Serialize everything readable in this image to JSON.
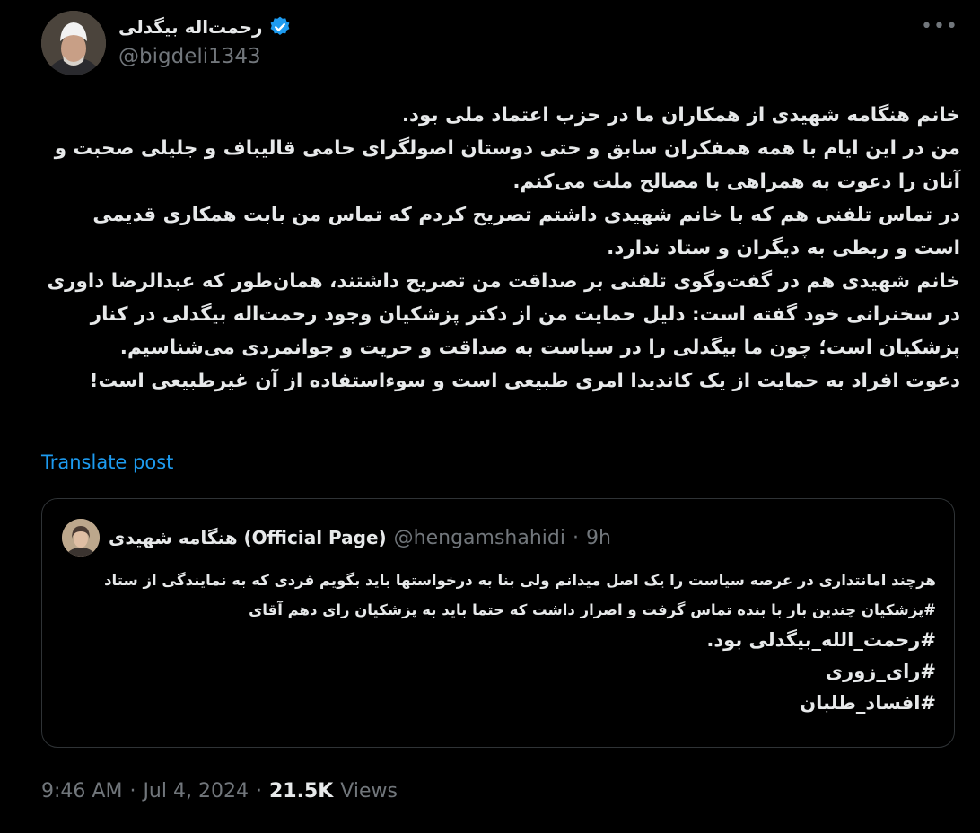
{
  "author": {
    "display_name": "رحمت‌اله بیگدلی",
    "handle": "@bigdeli1343",
    "verified": true,
    "avatar_icon": "person-avatar-icon"
  },
  "menu": {
    "more_label": "•••"
  },
  "tweet": {
    "paragraphs": [
      "خانم هنگامه شهیدی از همکاران ما در حزب اعتماد ملی بود.",
      "من در این ایام با همه همفکران سابق و حتی دوستان اصولگرای حامی قالیباف و جلیلی صحبت و آنان را دعوت به همراهی با مصالح ملت می‌کنم.",
      "در تماس تلفنی هم که با خانم شهیدی داشتم تصریح کردم که تماس من بابت همکاری قدیمی است و ربطی به دیگران و ستاد ندارد.",
      "خانم شهیدی هم در گفت‌وگوی تلفنی بر صداقت من تصریح داشتند، همان‌طور که عبدالرضا داوری در سخنرانی خود گفته است: دلیل حمایت من از دکتر پزشکیان وجود رحمت‌اله بیگدلی در کنار پزشکیان است؛ چون ما بیگدلی را در سیاست به صداقت و حریت و جوانمردی می‌شناسیم.",
      "دعوت افراد به حمایت از یک کاندیدا امری طبیعی است و سوءاستفاده از آن غیرطبیعی است!"
    ],
    "translate_label": "Translate post"
  },
  "quoted": {
    "display_name": "هنگامه شهیدی (Official Page)",
    "handle": "@hengamshahidi",
    "separator": "·",
    "time": "9h",
    "text_line": "هرچند امانتداری در عرصه سیاست را یک اصل میدانم ولی بنا به درخواستها باید بگویم فردی که به نمایندگی از ستاد #پزشکیان چندین بار با بنده تماس گرفت و اصرار داشت که حتما باید به پزشکیان رای دهم آقای",
    "tag_lines": [
      "#رحمت_الله_بیگدلی بود.",
      "#رای_زوری",
      "#افساد_طلبان"
    ]
  },
  "meta": {
    "time": "9:46 AM",
    "dot": "·",
    "date": "Jul 4, 2024",
    "views_count": "21.5K",
    "views_label": "Views"
  },
  "colors": {
    "background": "#000000",
    "text": "#e7e9ea",
    "secondary": "#71767b",
    "accent": "#1d9bf0",
    "border": "#2f3336"
  }
}
